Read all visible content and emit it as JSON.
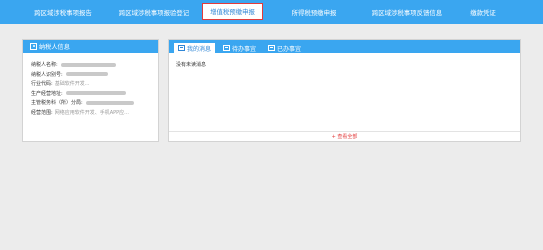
{
  "nav": {
    "items": [
      {
        "label": "跨区域涉税事项报告"
      },
      {
        "label": "跨区域涉税事项报验登记"
      },
      {
        "label": "增值税预缴申报",
        "active": true
      },
      {
        "label": "所得税预缴申报"
      },
      {
        "label": "跨区域涉税事项反馈信息"
      },
      {
        "label": "缴款凭证"
      }
    ]
  },
  "taxpayer": {
    "title": "纳税人信息",
    "fields": [
      {
        "label": "纳税人名称:",
        "value": ""
      },
      {
        "label": "纳税人识别号:",
        "value": ""
      },
      {
        "label": "行业代码:",
        "value": "基础软件开发..."
      },
      {
        "label": "生产经营地址:",
        "value": ""
      },
      {
        "label": "主管税务科（所）分局:",
        "value": ""
      },
      {
        "label": "经营范围:",
        "value": "网络应用软件开发、手机APP应..."
      }
    ]
  },
  "messages": {
    "tabs": [
      {
        "label": "我的消息",
        "icon": "message-icon",
        "active": true
      },
      {
        "label": "待办事宜",
        "icon": "todo-icon"
      },
      {
        "label": "已办事宜",
        "icon": "done-icon"
      }
    ],
    "empty_text": "没有未读消息",
    "view_all": "+ 查看全部"
  },
  "colors": {
    "nav_bg": "#3aa6f0",
    "accent": "#2f86d6",
    "highlight_border": "#e23b3b",
    "link_red": "#e23b3b"
  }
}
